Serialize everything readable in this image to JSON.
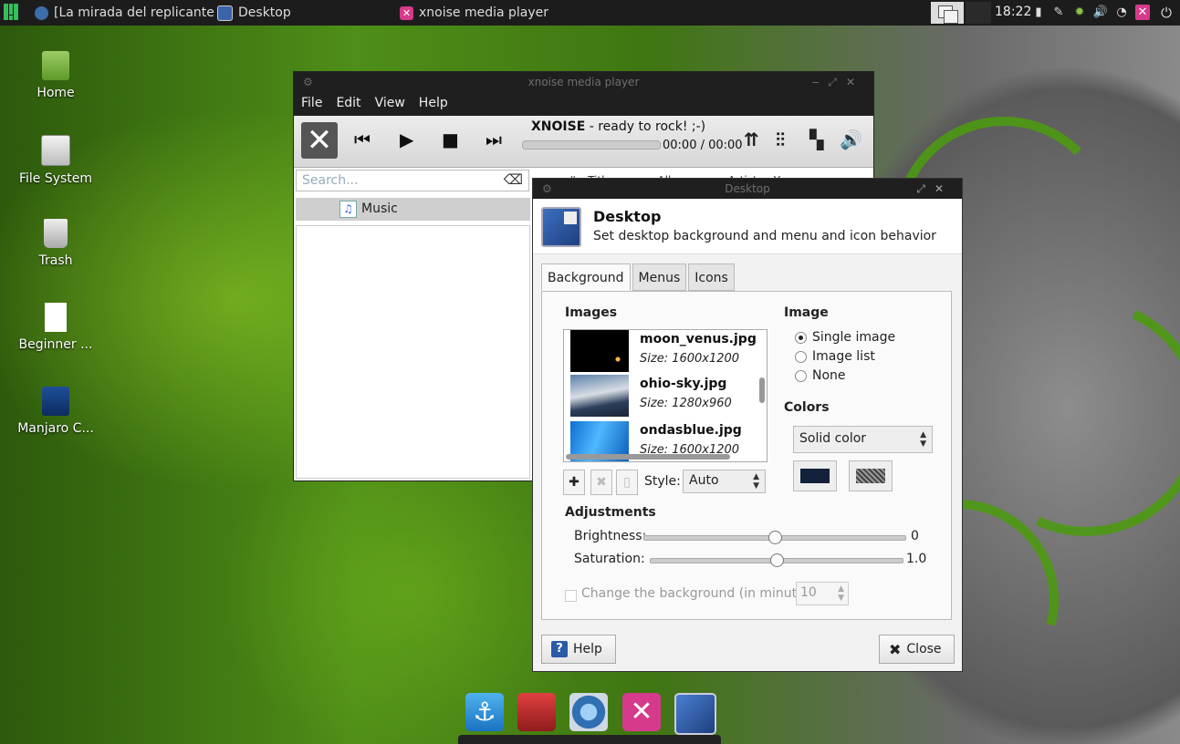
{
  "panel": {
    "tasks": [
      {
        "label": "[La mirada del replicante ..."
      },
      {
        "label": "Desktop"
      },
      {
        "label": "xnoise media player"
      }
    ],
    "clock": "18:22"
  },
  "desktop_icons": [
    {
      "label": "Home"
    },
    {
      "label": "File System"
    },
    {
      "label": "Trash"
    },
    {
      "label": "Beginner ..."
    },
    {
      "label": "Manjaro C..."
    }
  ],
  "xnoise": {
    "title": "xnoise media player",
    "menu": [
      "File",
      "Edit",
      "View",
      "Help"
    ],
    "now_playing_bold": "XNOISE",
    "now_playing_rest": " - ready to rock! ;-)",
    "progress": 0,
    "time": "00:00 / 00:00",
    "search_placeholder": "Search...",
    "library_item": "Music",
    "columns": [
      "#",
      "Titl",
      "Alb",
      "Artist",
      "Y"
    ]
  },
  "desktop_dialog": {
    "window_title": "Desktop",
    "header_title": "Desktop",
    "header_subtitle": "Set desktop background and menu and icon behavior",
    "tabs": [
      "Background",
      "Menus",
      "Icons"
    ],
    "active_tab": "Background",
    "images_label": "Images",
    "images": [
      {
        "name": "moon_venus.jpg",
        "size": "Size: 1600x1200"
      },
      {
        "name": "ohio-sky.jpg",
        "size": "Size: 1280x960"
      },
      {
        "name": "ondasblue.jpg",
        "size": "Size: 1600x1200"
      }
    ],
    "style_label": "Style:",
    "style_value": "Auto",
    "image_section": "Image",
    "image_options": [
      "Single image",
      "Image list",
      "None"
    ],
    "image_selected": "Single image",
    "colors_section": "Colors",
    "colors_value": "Solid color",
    "primary_color": "#14213a",
    "adjustments_label": "Adjustments",
    "brightness_label": "Brightness:",
    "brightness_value": "0",
    "brightness_fraction": 0.5,
    "saturation_label": "Saturation:",
    "saturation_value": "1.0",
    "saturation_fraction": 0.5,
    "change_bg_label": "Change the background (in minutes):",
    "change_bg_minutes": "10",
    "help_label": "Help",
    "close_label": "Close"
  }
}
